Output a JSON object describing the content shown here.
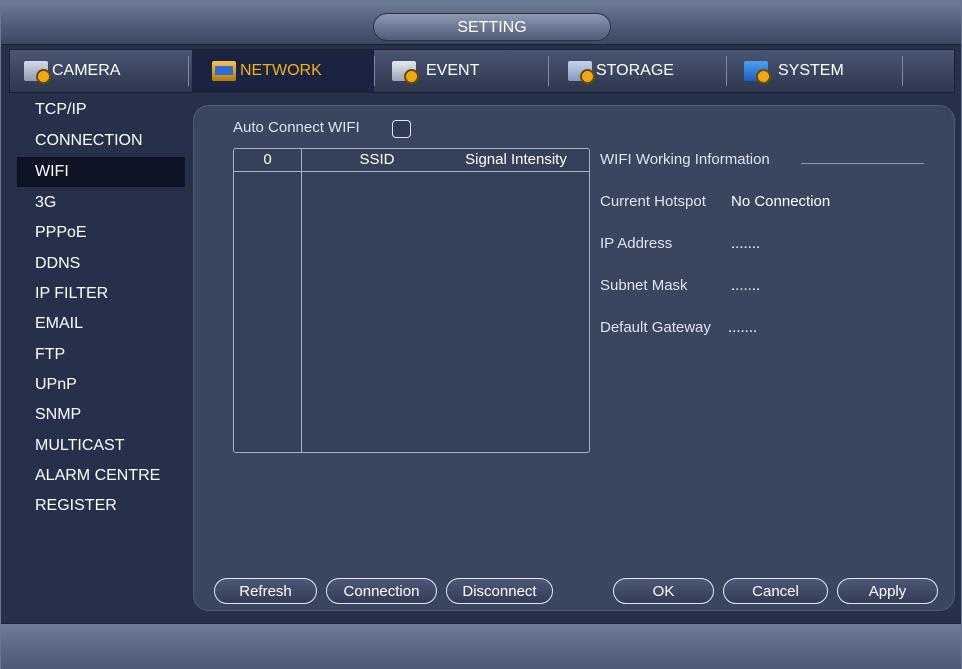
{
  "window": {
    "title": "SETTING"
  },
  "tabs": [
    {
      "label": "CAMERA",
      "icon": "camera-settings-icon"
    },
    {
      "label": "NETWORK",
      "icon": "network-icon",
      "active": true
    },
    {
      "label": "EVENT",
      "icon": "event-icon"
    },
    {
      "label": "STORAGE",
      "icon": "storage-icon"
    },
    {
      "label": "SYSTEM",
      "icon": "system-icon"
    }
  ],
  "sidebar": {
    "items": [
      {
        "label": "TCP/IP"
      },
      {
        "label": "CONNECTION"
      },
      {
        "label": "WIFI",
        "active": true
      },
      {
        "label": "3G"
      },
      {
        "label": "PPPoE"
      },
      {
        "label": "DDNS"
      },
      {
        "label": "IP FILTER"
      },
      {
        "label": "EMAIL"
      },
      {
        "label": "FTP"
      },
      {
        "label": "UPnP"
      },
      {
        "label": "SNMP"
      },
      {
        "label": "MULTICAST"
      },
      {
        "label": "ALARM CENTRE"
      },
      {
        "label": "REGISTER"
      }
    ]
  },
  "wifi": {
    "auto_connect_label": "Auto Connect WIFI",
    "auto_connect_checked": false,
    "table": {
      "headers": [
        "0",
        "SSID",
        "Signal Intensity"
      ],
      "rows": []
    },
    "info": {
      "title": "WIFI Working Information",
      "current_hotspot_label": "Current Hotspot",
      "current_hotspot_value": "No Connection",
      "ip_address_label": "IP Address",
      "ip_address_value": ".......",
      "subnet_mask_label": "Subnet Mask",
      "subnet_mask_value": ".......",
      "default_gateway_label": "Default Gateway",
      "default_gateway_value": "......."
    }
  },
  "buttons": {
    "refresh": "Refresh",
    "connection": "Connection",
    "disconnect": "Disconnect",
    "ok": "OK",
    "cancel": "Cancel",
    "apply": "Apply"
  },
  "colors": {
    "active_tab_text": "#f2b01e",
    "panel_bg": "#3a4560"
  }
}
